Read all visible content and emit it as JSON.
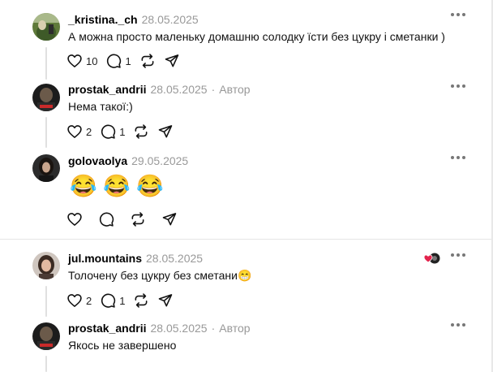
{
  "colors": {
    "accent_like": "#e3244d",
    "muted": "#999999"
  },
  "posts": [
    {
      "username": "_kristina._ch",
      "date": "28.05.2025",
      "text": "А можна просто маленьку домашню солодку їсти без цукру і сметанки )",
      "likes": "10",
      "replies": "1"
    },
    {
      "username": "prostak_andrii",
      "date": "28.05.2025",
      "dot": "·",
      "author": "Автор",
      "text": "Нема такої:)",
      "likes": "2",
      "replies": "1"
    },
    {
      "username": "golovaolya",
      "date": "29.05.2025",
      "emojis": "😂 😂 😂"
    },
    {
      "username": "jul.mountains",
      "date": "28.05.2025",
      "text": "Толочену без цукру без сметани😁",
      "likes": "2",
      "replies": "1"
    },
    {
      "username": "prostak_andrii",
      "date": "28.05.2025",
      "dot": "·",
      "author": "Автор",
      "text": "Якось не завершено"
    }
  ],
  "icons": [
    "heart-icon",
    "comment-icon",
    "repost-icon",
    "share-icon",
    "more-icon"
  ]
}
